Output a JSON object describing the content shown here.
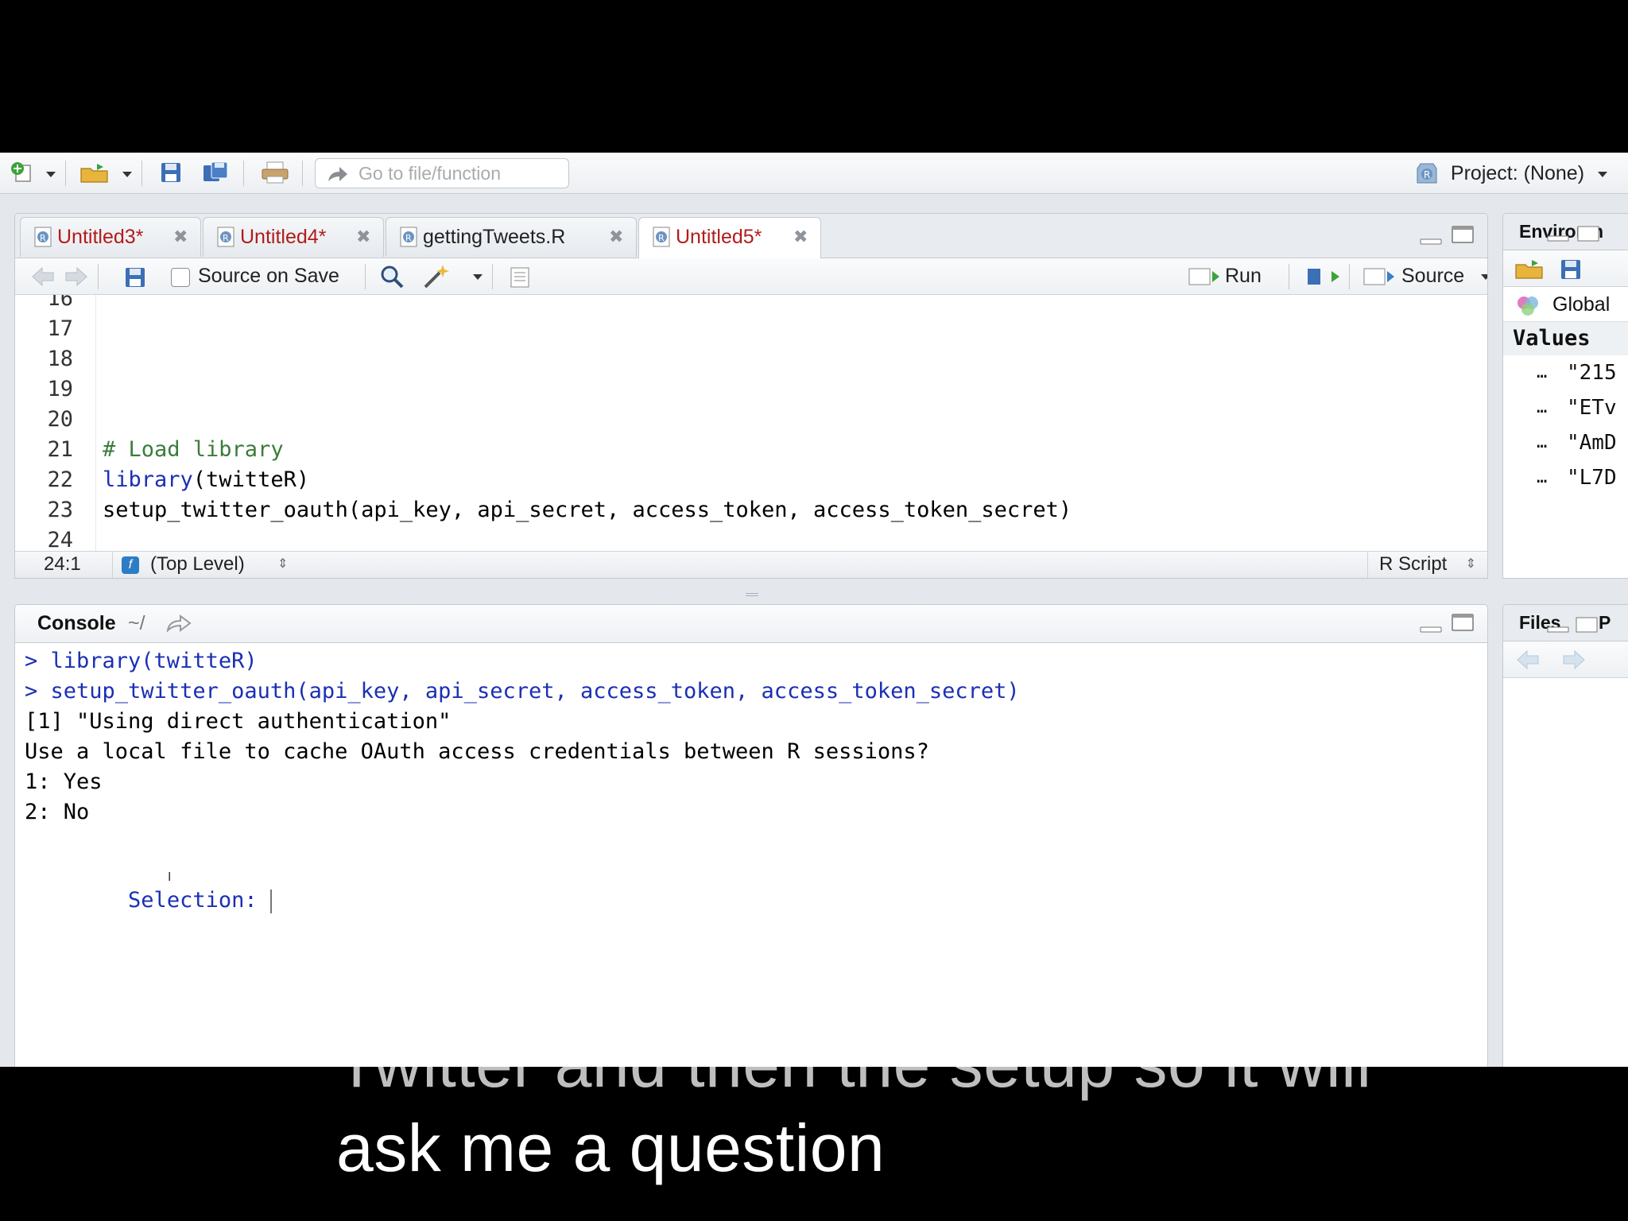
{
  "toolbar": {
    "goto_placeholder": "Go to file/function",
    "project_label": "Project: (None)"
  },
  "source_tabs": [
    {
      "label": "Untitled3*",
      "modified": true
    },
    {
      "label": "Untitled4*",
      "modified": true
    },
    {
      "label": "gettingTweets.R",
      "modified": false
    },
    {
      "label": "Untitled5*",
      "modified": true,
      "active": true
    }
  ],
  "source_toolbar": {
    "source_on_save": "Source on Save",
    "run": "Run",
    "source": "Source"
  },
  "editor": {
    "lines": [
      {
        "num": "16",
        "text": ""
      },
      {
        "num": "17",
        "text": ""
      },
      {
        "num": "18",
        "text": ""
      },
      {
        "num": "19",
        "text": ""
      },
      {
        "num": "20",
        "text": ""
      },
      {
        "num": "21",
        "comment": "# Load library"
      },
      {
        "num": "22",
        "fn": "library",
        "rest": "(twitteR)"
      },
      {
        "num": "23",
        "text": "setup_twitter_oauth(api_key, api_secret, access_token, access_token_secret)"
      },
      {
        "num": "24",
        "text": ""
      }
    ],
    "status_position": "24:1",
    "status_scope": "(Top Level)",
    "status_filetype": "R Script"
  },
  "console": {
    "title": "Console",
    "path": "~/",
    "lines": [
      {
        "text": "> library(twitteR)",
        "blue": true
      },
      {
        "text": "> setup_twitter_oauth(api_key, api_secret, access_token, access_token_secret)",
        "blue": true
      },
      {
        "text": "[1] \"Using direct authentication\"",
        "blue": false
      },
      {
        "text": "Use a local file to cache OAuth access credentials between R sessions?",
        "blue": false
      },
      {
        "text": "1: Yes",
        "blue": false
      },
      {
        "text": "2: No",
        "blue": false
      }
    ],
    "prompt": "Selection: "
  },
  "environment": {
    "tab": "Environm",
    "scope": "Global",
    "section": "Values",
    "values": [
      {
        "name": "…",
        "value": "\"215"
      },
      {
        "name": "…",
        "value": "\"ETv"
      },
      {
        "name": "…",
        "value": "\"AmD"
      },
      {
        "name": "…",
        "value": "\"L7D"
      }
    ]
  },
  "files_pane": {
    "tab": "Files",
    "tab2": "P"
  },
  "subtitles": {
    "line1": "Twitter and then the setup so it will",
    "line2": "ask me a question"
  }
}
